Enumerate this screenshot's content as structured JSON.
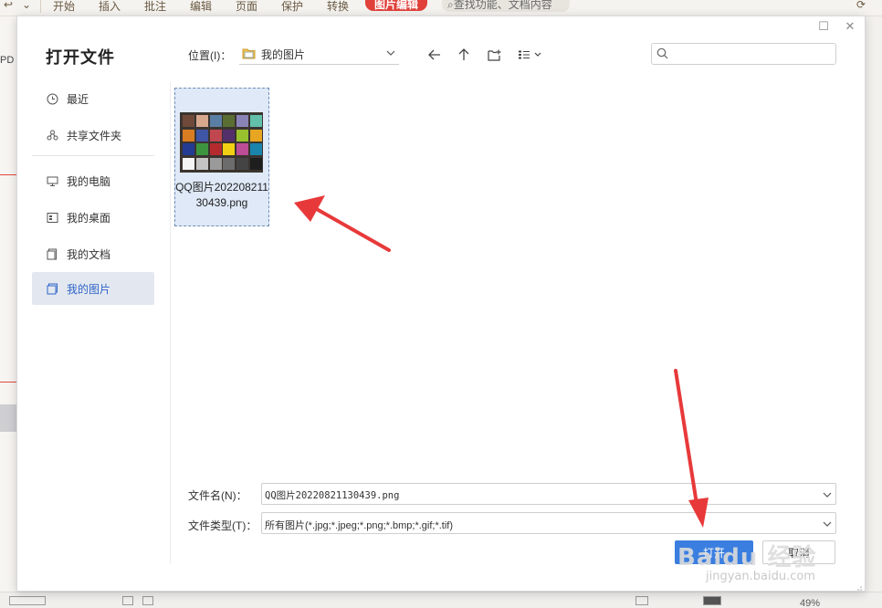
{
  "app": {
    "tabs": [
      "开始",
      "插入",
      "批注",
      "编辑",
      "页面",
      "保护",
      "转换",
      "图片编辑"
    ],
    "search_placeholder": "查找功能、文档内容",
    "left_label": "PD",
    "zoom": "49%"
  },
  "dialog": {
    "title": "打开文件",
    "sidebar": [
      {
        "label": "最近",
        "icon": "clock-icon"
      },
      {
        "label": "共享文件夹",
        "icon": "share-icon"
      },
      {
        "label": "我的电脑",
        "icon": "computer-icon"
      },
      {
        "label": "我的桌面",
        "icon": "desktop-icon"
      },
      {
        "label": "我的文档",
        "icon": "document-icon"
      },
      {
        "label": "我的图片",
        "icon": "picture-folder-icon",
        "active": true
      }
    ],
    "location_label": "位置(I)：",
    "location_value": "我的图片",
    "search_placeholder": "",
    "files": [
      {
        "name": "QQ图片20220821130439.png",
        "selected": true
      }
    ],
    "filename_label": "文件名(N)：",
    "filename_value": "QQ图片20220821130439.png",
    "filetype_label": "文件类型(T)：",
    "filetype_value": "所有图片(*.jpg;*.jpeg;*.png;*.bmp;*.gif;*.tif)",
    "open_button": "打开",
    "cancel_button": "取消"
  },
  "watermark": {
    "logo": "Baidu 经验",
    "url": "jingyan.baidu.com"
  },
  "colors": {
    "accent": "#3a7ee0",
    "sidebar_active_bg": "#e3e8f0",
    "sidebar_active_text": "#2f64c8",
    "selection_bg": "#dfe9f7",
    "arrow_red": "#e8393a",
    "app_tab_active": "#e0413a"
  }
}
